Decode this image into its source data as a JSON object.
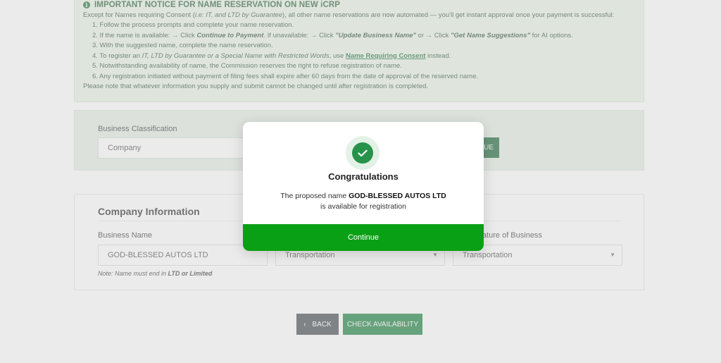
{
  "notice": {
    "title": "IMPORTANT NOTICE FOR NAME RESERVATION ON NEW iCRP",
    "intro_a": "Except for Names requiring Consent (",
    "intro_b": "i.e: IT, and LTD by Guarantee",
    "intro_c": "), all other name reservations are now automated — you'll get instant approval once your payment is successful:",
    "item1": "1. Follow the process prompts and complete your name reservation.",
    "item2_a": "2. If the name is available: → Click ",
    "item2_b": "Continue to Payment",
    "item2_c": ". If unavailable: → Click ",
    "item2_d": "\"Update Business Name\"",
    "item2_e": " or → Click ",
    "item2_f": "\"Get Name Suggestions\"",
    "item2_g": " for AI options.",
    "item3": "3. With the suggested name, complete the name reservation.",
    "item4_a": "4. To register an ",
    "item4_b": "IT, LTD by Guarantee or a Special Name with Restricted Words",
    "item4_c": ", use ",
    "item4_d": "Name Requiring Consent",
    "item4_e": " instead.",
    "item5": "5. Notwithstanding availability of name, the Commission reserves the right to refuse registration of name.",
    "item6": "6. Any registration initiated without payment of filing fees shall expire after 60 days from the date of approval of the reserved name.",
    "closing": "Please note that whatever information you supply and submit cannot be changed until after registration is completed."
  },
  "classification": {
    "label": "Business Classification",
    "value": "Company",
    "button_fragment": "UE"
  },
  "company": {
    "title": "Company Information",
    "business_name_label": "Business Name",
    "business_name_value": "GOD-BLESSED AUTOS LTD",
    "sector_value": "Transportation",
    "nature_label_fragment": "Nature of Business",
    "nature_value": "Transportation",
    "note_a": "Note: Name must end in ",
    "note_b": "LTD or Limited"
  },
  "buttons": {
    "back": "BACK",
    "check": "CHECK AVAILABILITY"
  },
  "modal": {
    "title": "Congratulations",
    "msg_a": "The proposed name ",
    "msg_name": "GOD-BLESSED AUTOS LTD",
    "msg_b": "is available for registration",
    "continue": "Continue"
  },
  "colors": {
    "brand_green": "#0d7a36",
    "success_green": "#0aa015",
    "back_gray": "#3d4348"
  },
  "icons": {
    "notice": "info-icon",
    "success": "check-circle-icon",
    "back": "chevron-left-icon",
    "dropdown": "caret-down-icon"
  }
}
